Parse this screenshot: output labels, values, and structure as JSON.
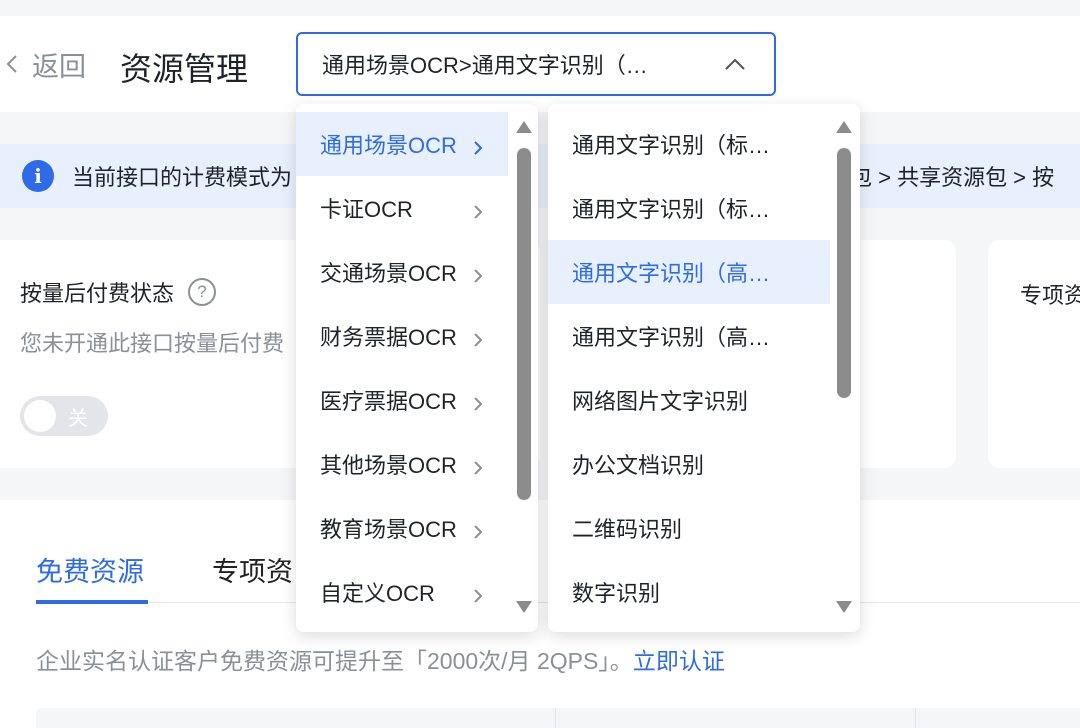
{
  "header": {
    "back_label": "返回",
    "page_title": "资源管理",
    "api_select_value": "通用场景OCR>通用文字识别（…"
  },
  "notice": {
    "text_left": "当前接口的计费模式为",
    "text_right": "源包 > 共享资源包 > 按"
  },
  "billing": {
    "title": "按量后付费状态",
    "description": "您未开通此接口按量后付费",
    "toggle_label": "关",
    "toggle_on": false
  },
  "special_card": {
    "title": "专项资"
  },
  "tabs": [
    {
      "label": "免费资源",
      "active": true
    },
    {
      "label": "专项资",
      "active": false
    }
  ],
  "free_note": {
    "text": "企业实名认证客户免费资源可提升至「2000次/月 2QPS」。",
    "link": "立即认证"
  },
  "cascader": {
    "level1": [
      {
        "label": "通用场景OCR",
        "selected": true
      },
      {
        "label": "卡证OCR",
        "selected": false
      },
      {
        "label": "交通场景OCR",
        "selected": false
      },
      {
        "label": "财务票据OCR",
        "selected": false
      },
      {
        "label": "医疗票据OCR",
        "selected": false
      },
      {
        "label": "其他场景OCR",
        "selected": false
      },
      {
        "label": "教育场景OCR",
        "selected": false
      },
      {
        "label": "自定义OCR",
        "selected": false
      }
    ],
    "level2": [
      {
        "label": "通用文字识别（标…",
        "selected": false
      },
      {
        "label": "通用文字识别（标…",
        "selected": false
      },
      {
        "label": "通用文字识别（高…",
        "selected": true
      },
      {
        "label": "通用文字识别（高…",
        "selected": false
      },
      {
        "label": "网络图片文字识别",
        "selected": false
      },
      {
        "label": "办公文档识别",
        "selected": false
      },
      {
        "label": "二维码识别",
        "selected": false
      },
      {
        "label": "数字识别",
        "selected": false
      }
    ]
  },
  "colors": {
    "accent": "#2e6be6",
    "selected_bg": "#e8f0fd",
    "muted_text": "#8a8f99",
    "page_bg": "#f5f6f8"
  },
  "icons": {
    "back": "chevron-left-icon",
    "select_caret": "chevron-up-icon",
    "info": "info-icon",
    "help": "question-circle-icon",
    "option_arrow": "chevron-right-icon",
    "scroll_up": "triangle-up-icon",
    "scroll_down": "triangle-down-icon"
  }
}
